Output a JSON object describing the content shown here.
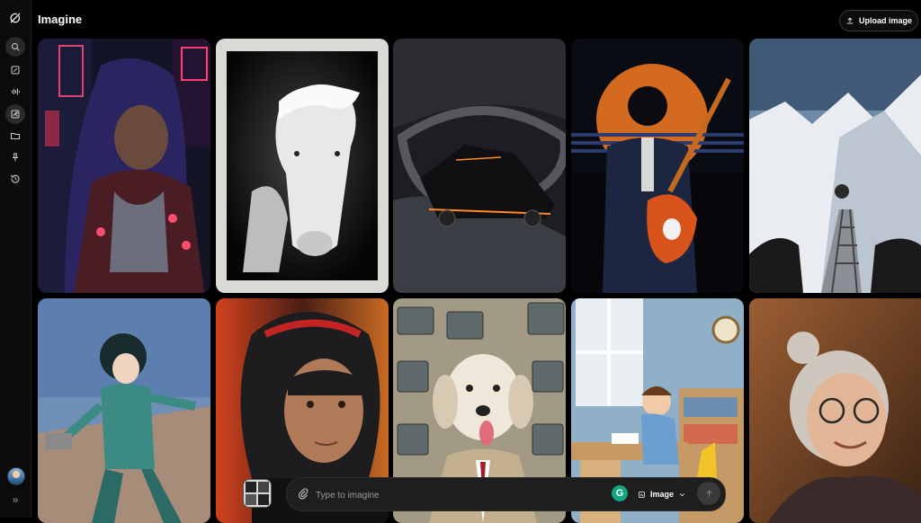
{
  "header": {
    "title": "Imagine",
    "upload_label": "Upload image"
  },
  "sidebar": {
    "items": [
      {
        "icon": "search-icon"
      },
      {
        "icon": "edit-icon"
      },
      {
        "icon": "voice-icon"
      },
      {
        "icon": "imagine-icon"
      },
      {
        "icon": "folder-icon"
      },
      {
        "icon": "pin-icon"
      },
      {
        "icon": "history-icon"
      }
    ]
  },
  "gallery": {
    "items": [
      {
        "subject": "anime cyberpunk girl, neon Tokyo"
      },
      {
        "subject": "black and white horse portrait"
      },
      {
        "subject": "futuristic sports car on swirling road"
      },
      {
        "subject": "guitarist silhouette at sunset"
      },
      {
        "subject": "climbing ladder on snowy mountain"
      },
      {
        "subject": "anime girl in green bodysuit"
      },
      {
        "subject": "racing driver in helmet"
      },
      {
        "subject": "dog in suit with TV screens"
      },
      {
        "subject": "cartoon boy reading in room"
      },
      {
        "subject": "smiling elderly woman with glasses"
      }
    ]
  },
  "composer": {
    "placeholder": "Type to imagine",
    "mode_label": "Image",
    "grammarly_letter": "G"
  },
  "colors": {
    "background": "#000000",
    "accent_green": "#14a37f"
  }
}
